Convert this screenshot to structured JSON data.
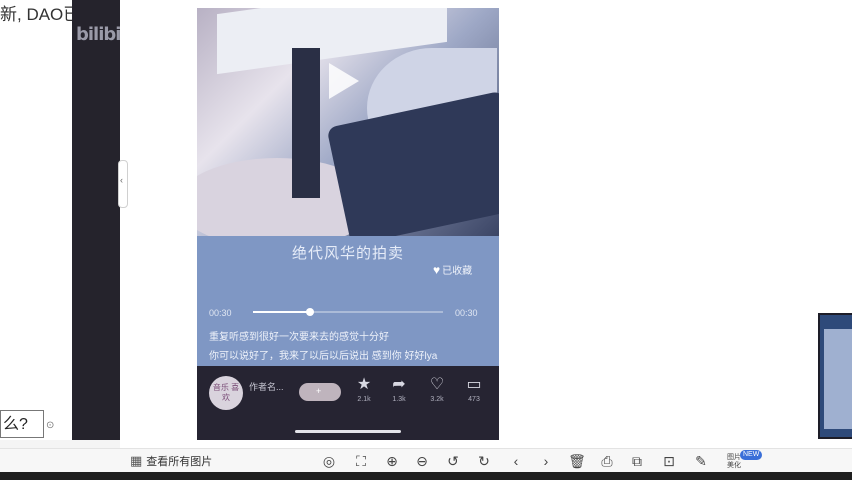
{
  "left_app": {
    "top_text": "新, DAO已超过",
    "bottom_text": "么?",
    "logo_text": "bilibili"
  },
  "song": {
    "title": "绝代风华的拍卖",
    "favorite_label": "已收藏",
    "time_current": "00:30",
    "time_total": "00:30",
    "progress": 0.3,
    "lyric_line1": "重复听感到很好一次要来去的感觉十分好",
    "lyric_line2": "你可以说好了，我来了以后以后说出 感到你 好好lya"
  },
  "bottom_bar": {
    "avatar_text": "音乐 喜欢",
    "username": "作者名...",
    "follow_label": "+",
    "actions": [
      {
        "icon": "★",
        "name": "star-icon",
        "count": "2.1k"
      },
      {
        "icon": "➦",
        "name": "share-icon",
        "count": "1.3k"
      },
      {
        "icon": "♡",
        "name": "like-icon",
        "count": "3.2k"
      },
      {
        "icon": "▭",
        "name": "comment-icon",
        "count": "473"
      }
    ]
  },
  "toolbar": {
    "view_all_label": "查看所有图片",
    "beauty_label": "图片 美化",
    "new_badge": "NEW",
    "icons": [
      {
        "name": "mouse-icon",
        "glyph": "◎"
      },
      {
        "name": "fit-screen-icon",
        "glyph": "⛶"
      },
      {
        "name": "zoom-in-icon",
        "glyph": "⊕"
      },
      {
        "name": "zoom-out-icon",
        "glyph": "⊖"
      },
      {
        "name": "rotate-left-icon",
        "glyph": "↺"
      },
      {
        "name": "rotate-right-icon",
        "glyph": "↻"
      },
      {
        "name": "previous-icon",
        "glyph": "‹"
      },
      {
        "name": "next-icon",
        "glyph": "›"
      },
      {
        "name": "delete-icon",
        "glyph": "🗑"
      },
      {
        "name": "print-icon",
        "glyph": "⎙"
      },
      {
        "name": "compare-icon",
        "glyph": "⧉"
      },
      {
        "name": "crop-icon",
        "glyph": "⊡"
      },
      {
        "name": "edit-icon",
        "glyph": "✎"
      }
    ]
  }
}
